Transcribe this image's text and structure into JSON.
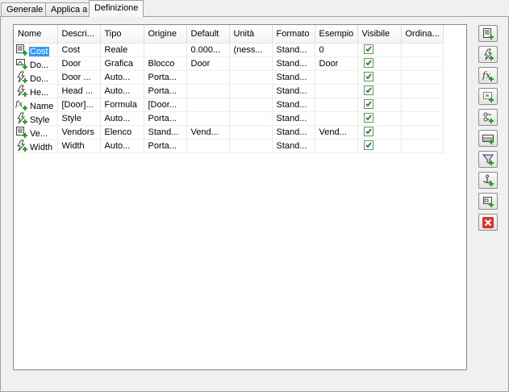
{
  "tabs": [
    {
      "label": "Generale",
      "active": false
    },
    {
      "label": "Applica a",
      "active": false
    },
    {
      "label": "Definizione",
      "active": true
    }
  ],
  "table": {
    "columns": [
      "Nome",
      "Descri...",
      "Tipo",
      "Origine",
      "Default",
      "Unità",
      "Formato",
      "Esempio",
      "Visibile",
      "Ordina..."
    ],
    "rows": [
      {
        "icon": "table-property-icon",
        "name": "Cost",
        "selected": true,
        "descrizione": "Cost",
        "tipo": "Reale",
        "origine": "",
        "default": "0.000...",
        "unita": "(ness...",
        "formato": "Stand...",
        "esempio": "0",
        "visibile": true,
        "ordina": ""
      },
      {
        "icon": "graphic-property-icon",
        "name": "Do...",
        "selected": false,
        "descrizione": "Door",
        "tipo": "Grafica",
        "origine": "Blocco",
        "default": "Door",
        "unita": "",
        "formato": "Stand...",
        "esempio": "Door",
        "visibile": true,
        "ordina": ""
      },
      {
        "icon": "auto-property-icon",
        "name": "Do...",
        "selected": false,
        "descrizione": "Door ...",
        "tipo": "Auto...",
        "origine": "Porta...",
        "default": "",
        "unita": "",
        "formato": "Stand...",
        "esempio": "",
        "visibile": true,
        "ordina": ""
      },
      {
        "icon": "auto-property-icon",
        "name": "He...",
        "selected": false,
        "descrizione": "Head ...",
        "tipo": "Auto...",
        "origine": "Porta...",
        "default": "",
        "unita": "",
        "formato": "Stand...",
        "esempio": "",
        "visibile": true,
        "ordina": ""
      },
      {
        "icon": "formula-property-icon",
        "name": "Name",
        "selected": false,
        "descrizione": "[Door]...",
        "tipo": "Formula",
        "origine": "[Door...",
        "default": "",
        "unita": "",
        "formato": "Stand...",
        "esempio": "",
        "visibile": true,
        "ordina": ""
      },
      {
        "icon": "auto-property-icon",
        "name": "Style",
        "selected": false,
        "descrizione": "Style",
        "tipo": "Auto...",
        "origine": "Porta...",
        "default": "",
        "unita": "",
        "formato": "Stand...",
        "esempio": "",
        "visibile": true,
        "ordina": ""
      },
      {
        "icon": "list-property-icon",
        "name": "Ve...",
        "selected": false,
        "descrizione": "Vendors",
        "tipo": "Elenco",
        "origine": "Stand...",
        "default": "Vend...",
        "unita": "",
        "formato": "Stand...",
        "esempio": "Vend...",
        "visibile": true,
        "ordina": ""
      },
      {
        "icon": "auto-property-icon",
        "name": "Width",
        "selected": false,
        "descrizione": "Width",
        "tipo": "Auto...",
        "origine": "Porta...",
        "default": "",
        "unita": "",
        "formato": "Stand...",
        "esempio": "",
        "visibile": true,
        "ordina": ""
      }
    ]
  },
  "side_buttons": [
    "add-manual-property-icon",
    "add-auto-property-icon",
    "add-formula-property-icon",
    "add-location-property-icon",
    "add-classification-property-icon",
    "add-material-property-icon",
    "add-graphic-property-icon",
    "add-anchor-property-icon",
    "add-list-property-icon",
    "delete-property-icon"
  ],
  "colors": {
    "selection": "#3399ff",
    "plus_green": "#2a9a2a",
    "delete_red": "#d9302a",
    "check_green": "#2f8f2f"
  }
}
